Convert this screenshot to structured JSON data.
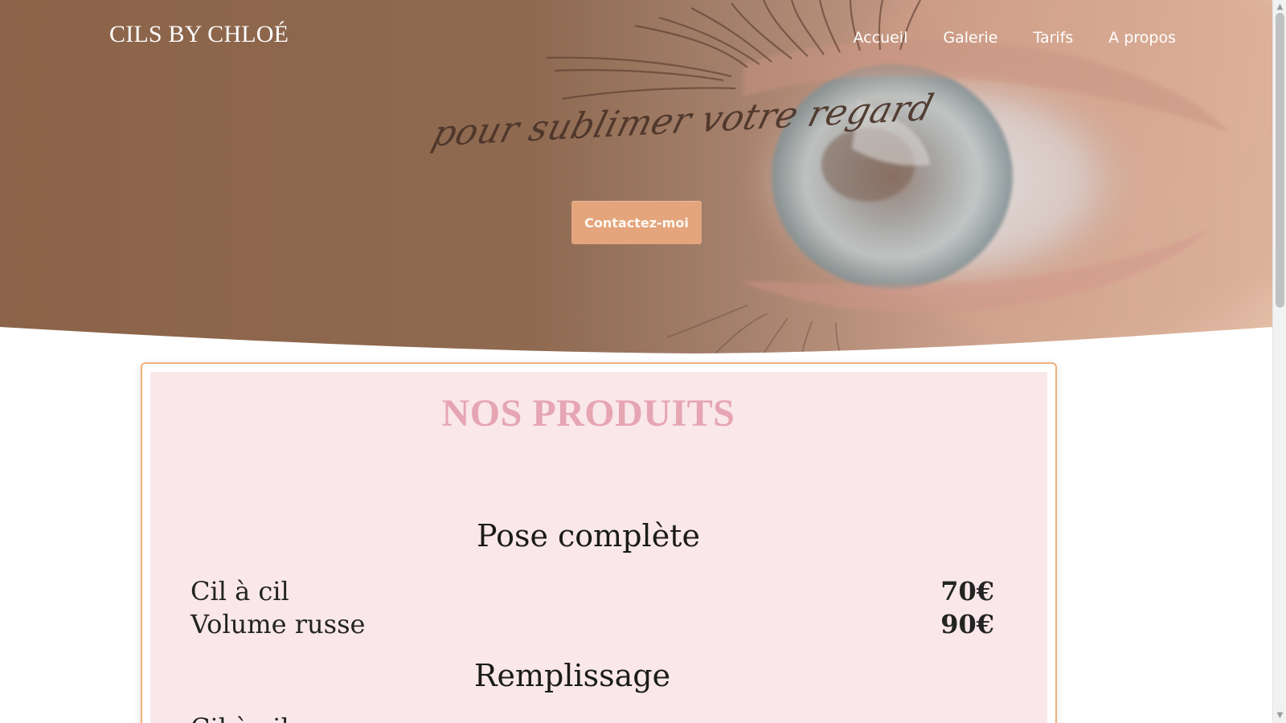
{
  "brand": "CILS BY CHLOÉ",
  "nav": {
    "items": [
      "Accueil",
      "Galerie",
      "Tarifs",
      "A propos"
    ]
  },
  "hero": {
    "tagline": "pour sublimer votre regard",
    "cta_label": "Contactez-moi"
  },
  "products": {
    "title": "NOS PRODUITS",
    "categories": [
      {
        "title": "Pose complète",
        "items": [
          {
            "name": "Cil à cil",
            "price": "70€"
          },
          {
            "name": "Volume russe",
            "price": "90€"
          }
        ]
      },
      {
        "title": "Remplissage",
        "items": [
          {
            "name": "Cil à cil",
            "price": ""
          }
        ]
      }
    ]
  },
  "colors": {
    "hero_brown": "#8b6348",
    "cta": "#e4a57d",
    "card_border": "#f0b17d",
    "card_bg": "#f9e7e9",
    "section_title": "#e6a5b2"
  },
  "icons": {
    "scroll_up": "chevron-up-icon",
    "scroll_down": "chevron-down-icon"
  }
}
